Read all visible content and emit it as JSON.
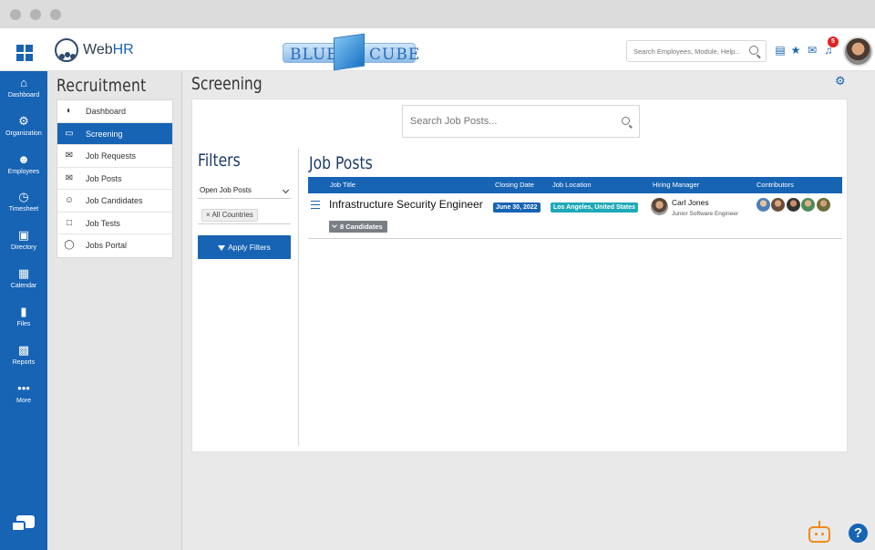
{
  "app": {
    "name_prefix": "Web",
    "name_suffix": "HR",
    "brand_left": "BLUE",
    "brand_right": "CUBE",
    "search_placeholder": "Search Employees, Module, Help...",
    "notification_count": "5",
    "accent": "#1763b4"
  },
  "sidebar": {
    "items": [
      {
        "label": "Dashboard",
        "icon": "home-icon"
      },
      {
        "label": "Organization",
        "icon": "gear-icon"
      },
      {
        "label": "Employees",
        "icon": "users-icon"
      },
      {
        "label": "Timesheet",
        "icon": "clock-icon"
      },
      {
        "label": "Directory",
        "icon": "id-card-icon"
      },
      {
        "label": "Calendar",
        "icon": "calendar-icon"
      },
      {
        "label": "Files",
        "icon": "folder-icon"
      },
      {
        "label": "Reports",
        "icon": "bar-chart-icon"
      },
      {
        "label": "More",
        "icon": "more-icon"
      }
    ]
  },
  "subnav": {
    "title": "Recruitment",
    "items": [
      {
        "label": "Dashboard",
        "icon": "gauge-icon"
      },
      {
        "label": "Screening",
        "icon": "monitor-icon"
      },
      {
        "label": "Job Requests",
        "icon": "envelope-open-icon"
      },
      {
        "label": "Job Posts",
        "icon": "envelope-icon"
      },
      {
        "label": "Job Candidates",
        "icon": "person-icon"
      },
      {
        "label": "Job Tests",
        "icon": "clipboard-icon"
      },
      {
        "label": "Jobs Portal",
        "icon": "globe-icon"
      }
    ]
  },
  "main": {
    "title": "Screening",
    "search_placeholder": "Search Job Posts...",
    "filters": {
      "title": "Filters",
      "status_select": "Open Job Posts",
      "country_tag": "All Countries",
      "apply_label": "Apply Filters"
    },
    "job_posts": {
      "title": "Job Posts",
      "columns": [
        "Job Title",
        "Closing Date",
        "Job Location",
        "Hiring Manager",
        "Contributors"
      ],
      "rows": [
        {
          "title": "Infrastructure Security Engineer",
          "closing_date": "June 30, 2022",
          "location": "Los Angeles, United States",
          "manager_name": "Carl Jones",
          "manager_role": "Junior Software Engineer",
          "candidates": "8 Candidates"
        }
      ]
    }
  }
}
